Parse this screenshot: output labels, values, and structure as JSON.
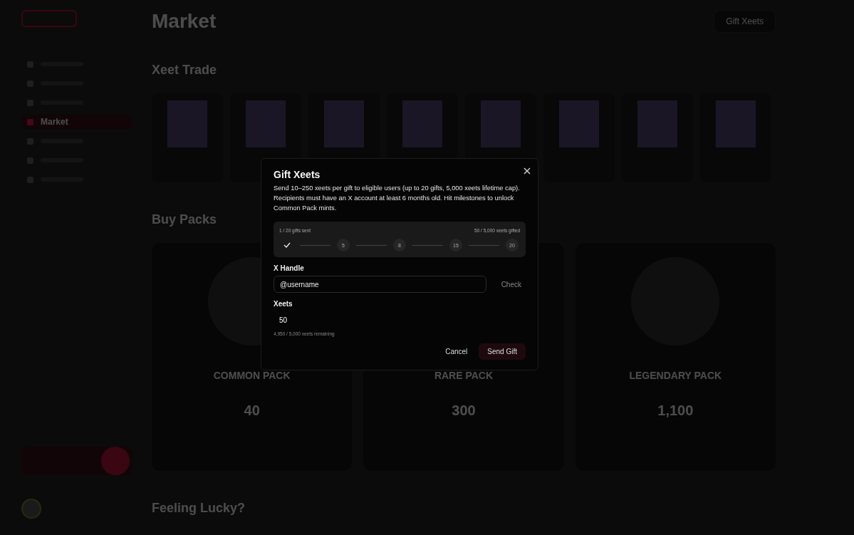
{
  "sidebar": {
    "items": [
      {
        "selected": false
      },
      {
        "selected": false
      },
      {
        "selected": false
      },
      {
        "label": "Market",
        "selected": true
      },
      {
        "selected": false
      },
      {
        "selected": false
      },
      {
        "selected": false
      }
    ]
  },
  "page": {
    "title": "Market",
    "header_button": "Gift Xeets"
  },
  "trade": {
    "title": "Xeet Trade"
  },
  "packs": {
    "title": "Buy Packs",
    "items": [
      {
        "name": "COMMON PACK",
        "price": "40"
      },
      {
        "name": "RARE PACK",
        "price": "300"
      },
      {
        "name": "LEGENDARY PACK",
        "price": "1,100"
      }
    ]
  },
  "lucky": {
    "title": "Feeling Lucky?"
  },
  "modal": {
    "title": "Gift Xeets",
    "description": "Send 10–250 xeets per gift to eligible users (up to 20 gifts, 5,000 xeets lifetime cap). Recipients must have an X account at least 6 months old. Hit milestones to unlock Common Pack mints.",
    "progress": {
      "sent": "1 / 20 gifts sent",
      "gifted": "50 / 5,000 xeets gifted",
      "milestones": [
        {
          "reached": true
        },
        {
          "label": "5",
          "reached": false
        },
        {
          "label": "8",
          "reached": false
        },
        {
          "label": "15",
          "reached": false
        },
        {
          "label": "20",
          "reached": false
        }
      ]
    },
    "handle": {
      "label": "X Handle",
      "placeholder": "@username",
      "check": "Check"
    },
    "xeets": {
      "label": "Xeets",
      "value": "50",
      "hint": "4,950 / 5,000 xeets remaining"
    },
    "buttons": {
      "cancel": "Cancel",
      "send": "Send Gift"
    }
  }
}
